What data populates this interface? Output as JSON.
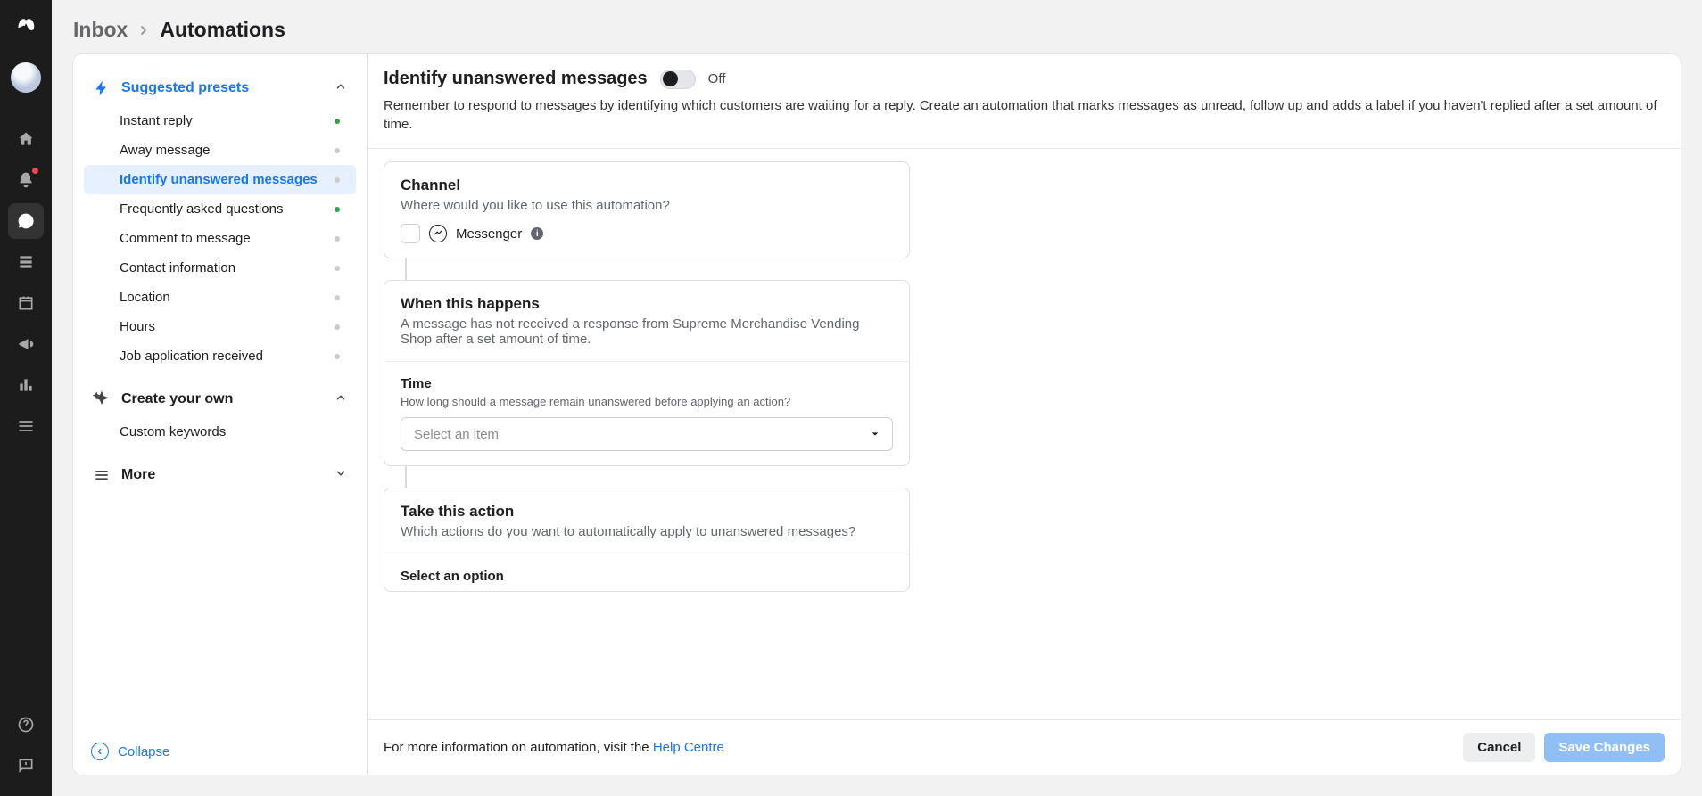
{
  "breadcrumb": {
    "inbox": "Inbox",
    "current": "Automations"
  },
  "sidebar": {
    "suggested_title": "Suggested presets",
    "create_title": "Create your own",
    "more_title": "More",
    "collapse": "Collapse",
    "presets": [
      {
        "label": "Instant reply",
        "on": true
      },
      {
        "label": "Away message",
        "on": false
      },
      {
        "label": "Identify unanswered messages",
        "on": false
      },
      {
        "label": "Frequently asked questions",
        "on": true
      },
      {
        "label": "Comment to message",
        "on": false
      },
      {
        "label": "Contact information",
        "on": false
      },
      {
        "label": "Location",
        "on": false
      },
      {
        "label": "Hours",
        "on": false
      },
      {
        "label": "Job application received",
        "on": false
      }
    ],
    "create_items": [
      {
        "label": "Custom keywords"
      }
    ]
  },
  "header": {
    "title": "Identify unanswered messages",
    "toggle_state": "Off",
    "description": "Remember to respond to messages by identifying which customers are waiting for a reply. Create an automation that marks messages as unread, follow up and adds a label if you haven't replied after a set amount of time."
  },
  "channel_card": {
    "title": "Channel",
    "sub": "Where would you like to use this automation?",
    "messenger_label": "Messenger"
  },
  "when_card": {
    "title": "When this happens",
    "sub": "A message has not received a response from Supreme Merchandise Vending Shop after a set amount of time.",
    "time_label": "Time",
    "time_hint": "How long should a message remain unanswered before applying an action?",
    "select_placeholder": "Select an item"
  },
  "action_card": {
    "title": "Take this action",
    "sub": "Which actions do you want to automatically apply to unanswered messages?",
    "select_label": "Select an option"
  },
  "footer": {
    "text": "For more information on automation, visit the ",
    "link": "Help Centre",
    "cancel": "Cancel",
    "save": "Save Changes"
  }
}
